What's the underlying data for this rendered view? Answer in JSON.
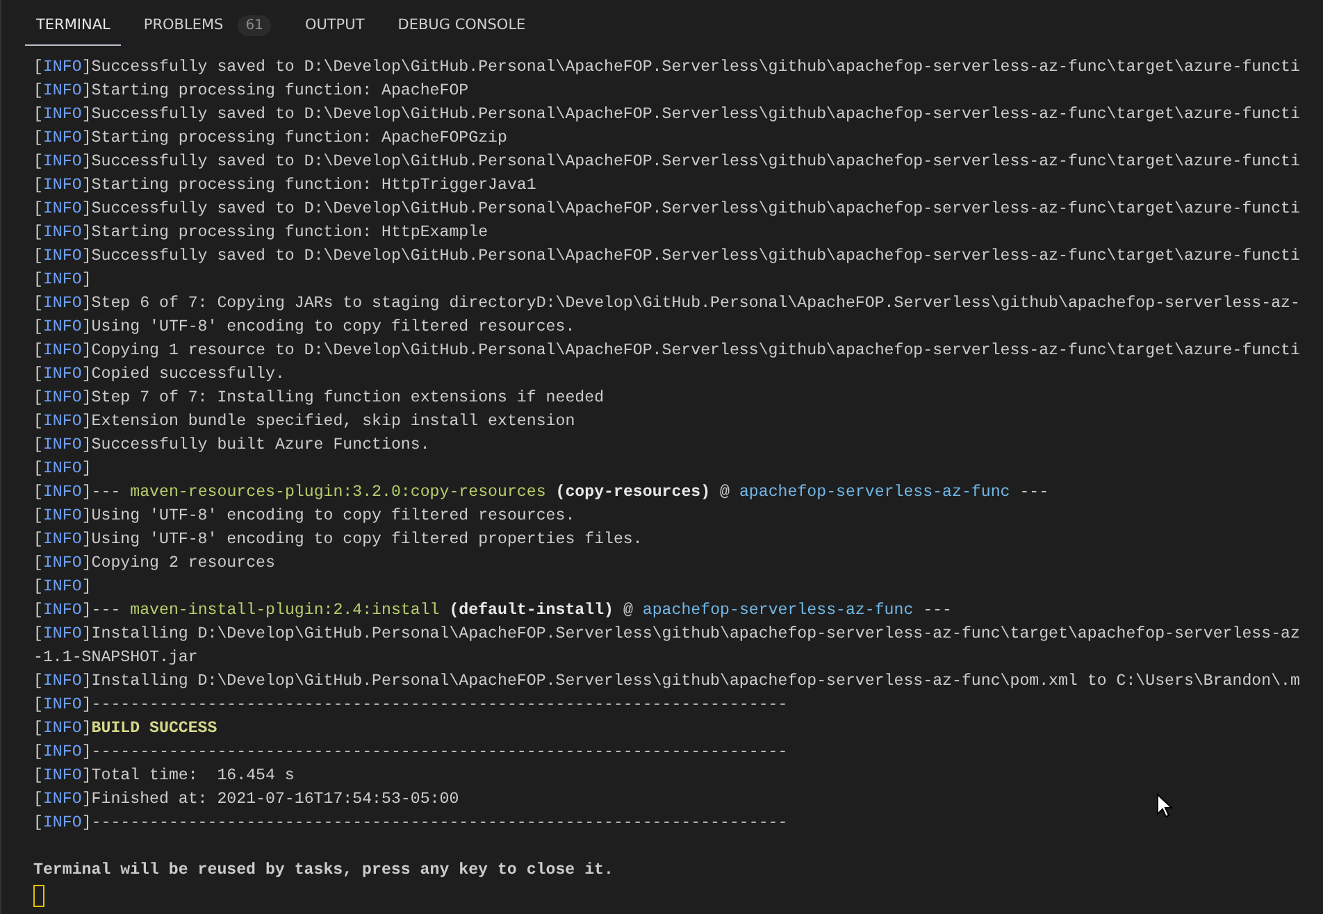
{
  "tabs": [
    {
      "label": "TERMINAL",
      "selected": true
    },
    {
      "label": "PROBLEMS",
      "selected": false,
      "badge": "61"
    },
    {
      "label": "OUTPUT",
      "selected": false
    },
    {
      "label": "DEBUG CONSOLE",
      "selected": false
    }
  ],
  "lines": [
    {
      "tag": "[INFO]",
      "segments": [
        {
          "kind": "plain",
          "text": "Successfully saved to D:\\Develop\\GitHub.Personal\\ApacheFOP.Serverless\\github\\apachefop-serverless-az-func\\target\\azure-functi"
        }
      ]
    },
    {
      "tag": "[INFO]",
      "segments": [
        {
          "kind": "plain",
          "text": "Starting processing function: ApacheFOP"
        }
      ]
    },
    {
      "tag": "[INFO]",
      "segments": [
        {
          "kind": "plain",
          "text": "Successfully saved to D:\\Develop\\GitHub.Personal\\ApacheFOP.Serverless\\github\\apachefop-serverless-az-func\\target\\azure-functi"
        }
      ]
    },
    {
      "tag": "[INFO]",
      "segments": [
        {
          "kind": "plain",
          "text": "Starting processing function: ApacheFOPGzip"
        }
      ]
    },
    {
      "tag": "[INFO]",
      "segments": [
        {
          "kind": "plain",
          "text": "Successfully saved to D:\\Develop\\GitHub.Personal\\ApacheFOP.Serverless\\github\\apachefop-serverless-az-func\\target\\azure-functi"
        }
      ]
    },
    {
      "tag": "[INFO]",
      "segments": [
        {
          "kind": "plain",
          "text": "Starting processing function: HttpTriggerJava1"
        }
      ]
    },
    {
      "tag": "[INFO]",
      "segments": [
        {
          "kind": "plain",
          "text": "Successfully saved to D:\\Develop\\GitHub.Personal\\ApacheFOP.Serverless\\github\\apachefop-serverless-az-func\\target\\azure-functi"
        }
      ]
    },
    {
      "tag": "[INFO]",
      "segments": [
        {
          "kind": "plain",
          "text": "Starting processing function: HttpExample"
        }
      ]
    },
    {
      "tag": "[INFO]",
      "segments": [
        {
          "kind": "plain",
          "text": "Successfully saved to D:\\Develop\\GitHub.Personal\\ApacheFOP.Serverless\\github\\apachefop-serverless-az-func\\target\\azure-functi"
        }
      ]
    },
    {
      "tag": "[INFO]"
    },
    {
      "tag": "[INFO]",
      "segments": [
        {
          "kind": "plain",
          "text": "Step 6 of 7: Copying JARs to staging directoryD:\\Develop\\GitHub.Personal\\ApacheFOP.Serverless\\github\\apachefop-serverless-az-"
        }
      ]
    },
    {
      "tag": "[INFO]",
      "segments": [
        {
          "kind": "plain",
          "text": "Using 'UTF-8' encoding to copy filtered resources."
        }
      ]
    },
    {
      "tag": "[INFO]",
      "segments": [
        {
          "kind": "plain",
          "text": "Copying 1 resource to D:\\Develop\\GitHub.Personal\\ApacheFOP.Serverless\\github\\apachefop-serverless-az-func\\target\\azure-functi"
        }
      ]
    },
    {
      "tag": "[INFO]",
      "segments": [
        {
          "kind": "plain",
          "text": "Copied successfully."
        }
      ]
    },
    {
      "tag": "[INFO]",
      "segments": [
        {
          "kind": "plain",
          "text": "Step 7 of 7: Installing function extensions if needed"
        }
      ]
    },
    {
      "tag": "[INFO]",
      "segments": [
        {
          "kind": "plain",
          "text": "Extension bundle specified, skip install extension"
        }
      ]
    },
    {
      "tag": "[INFO]",
      "segments": [
        {
          "kind": "plain",
          "text": "Successfully built Azure Functions."
        }
      ]
    },
    {
      "tag": "[INFO]"
    },
    {
      "tag": "[INFO]",
      "segments": [
        {
          "kind": "plain",
          "text": "--- "
        },
        {
          "kind": "plugin",
          "text": "maven-resources-plugin:3.2.0:copy-resources"
        },
        {
          "kind": "bold",
          "text": " (copy-resources)"
        },
        {
          "kind": "plain",
          "text": " @ "
        },
        {
          "kind": "project",
          "text": "apachefop-serverless-az-func"
        },
        {
          "kind": "plain",
          "text": " ---"
        }
      ]
    },
    {
      "tag": "[INFO]",
      "segments": [
        {
          "kind": "plain",
          "text": "Using 'UTF-8' encoding to copy filtered resources."
        }
      ]
    },
    {
      "tag": "[INFO]",
      "segments": [
        {
          "kind": "plain",
          "text": "Using 'UTF-8' encoding to copy filtered properties files."
        }
      ]
    },
    {
      "tag": "[INFO]",
      "segments": [
        {
          "kind": "plain",
          "text": "Copying 2 resources"
        }
      ]
    },
    {
      "tag": "[INFO]"
    },
    {
      "tag": "[INFO]",
      "segments": [
        {
          "kind": "plain",
          "text": "--- "
        },
        {
          "kind": "plugin",
          "text": "maven-install-plugin:2.4:install"
        },
        {
          "kind": "bold",
          "text": " (default-install)"
        },
        {
          "kind": "plain",
          "text": " @ "
        },
        {
          "kind": "project",
          "text": "apachefop-serverless-az-func"
        },
        {
          "kind": "plain",
          "text": " ---"
        }
      ]
    },
    {
      "tag": "[INFO]",
      "segments": [
        {
          "kind": "plain",
          "text": "Installing D:\\Develop\\GitHub.Personal\\ApacheFOP.Serverless\\github\\apachefop-serverless-az-func\\target\\apachefop-serverless-az"
        }
      ]
    },
    {
      "segments": [
        {
          "kind": "plain",
          "text": "-1.1-SNAPSHOT.jar"
        }
      ]
    },
    {
      "tag": "[INFO]",
      "segments": [
        {
          "kind": "plain",
          "text": "Installing D:\\Develop\\GitHub.Personal\\ApacheFOP.Serverless\\github\\apachefop-serverless-az-func\\pom.xml to C:\\Users\\Brandon\\.m"
        }
      ]
    },
    {
      "tag": "[INFO]",
      "segments": [
        {
          "kind": "plain",
          "text": "------------------------------------------------------------------------"
        }
      ]
    },
    {
      "tag": "[INFO]",
      "segments": [
        {
          "kind": "success",
          "text": "BUILD SUCCESS"
        }
      ]
    },
    {
      "tag": "[INFO]",
      "segments": [
        {
          "kind": "plain",
          "text": "------------------------------------------------------------------------"
        }
      ]
    },
    {
      "tag": "[INFO]",
      "segments": [
        {
          "kind": "plain",
          "text": "Total time:  16.454 s"
        }
      ]
    },
    {
      "tag": "[INFO]",
      "segments": [
        {
          "kind": "plain",
          "text": "Finished at: 2021-07-16T17:54:53-05:00"
        }
      ]
    },
    {
      "tag": "[INFO]",
      "segments": [
        {
          "kind": "plain",
          "text": "------------------------------------------------------------------------"
        }
      ]
    }
  ],
  "message": "Terminal will be reused by tasks, press any key to close it."
}
